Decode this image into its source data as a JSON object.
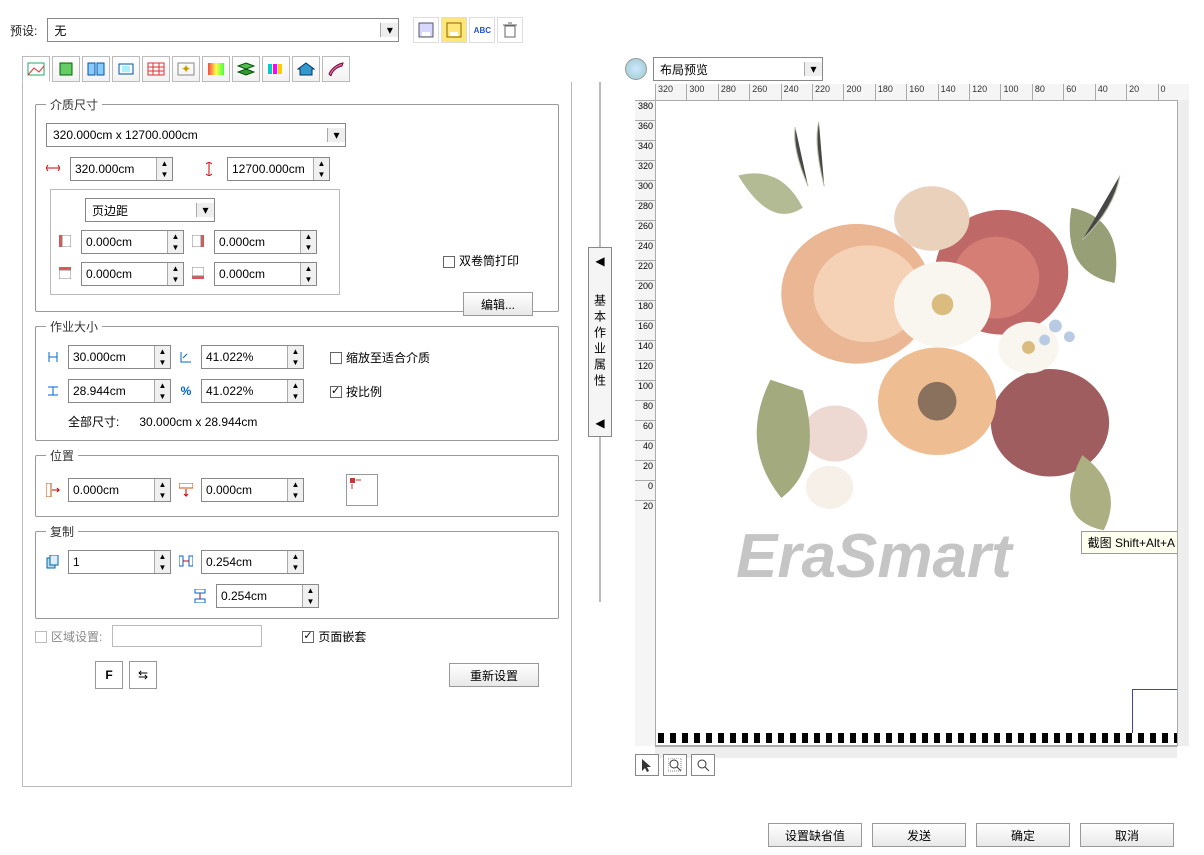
{
  "top": {
    "preset_label": "预设:",
    "preset_value": "无"
  },
  "top_icons": [
    "save-icon",
    "save-as-icon",
    "abc-icon",
    "delete-icon"
  ],
  "tabs": [
    "layout",
    "page",
    "tile",
    "crop",
    "grid",
    "stars",
    "gradients",
    "layers",
    "colors",
    "home",
    "brush"
  ],
  "media": {
    "legend": "介质尺寸",
    "size_combo": "320.000cm x 12700.000cm",
    "width": "320.000cm",
    "height": "12700.000cm",
    "margin_combo": "页边距",
    "m_left": "0.000cm",
    "m_right": "0.000cm",
    "m_top": "0.000cm",
    "m_bottom": "0.000cm",
    "double_roll": "双卷筒打印",
    "edit_btn": "编辑..."
  },
  "job": {
    "legend": "作业大小",
    "w": "30.000cm",
    "w_pct": "41.022%",
    "h": "28.944cm",
    "h_pct": "41.022%",
    "fit_media": "缩放至适合介质",
    "keep_ratio": "按比例",
    "total_label": "全部尺寸:",
    "total_value": "30.000cm x 28.944cm"
  },
  "pos": {
    "legend": "位置",
    "x": "0.000cm",
    "y": "0.000cm"
  },
  "copy": {
    "legend": "复制",
    "count": "1",
    "gx": "0.254cm",
    "gy": "0.254cm"
  },
  "area": {
    "label": "区域设置:",
    "nest": "页面嵌套",
    "reset": "重新设置"
  },
  "mid_tab": "基本作业属性",
  "preview": {
    "combo": "布局预览",
    "ruler_h": [
      "320",
      "300",
      "280",
      "260",
      "240",
      "220",
      "200",
      "180",
      "160",
      "140",
      "120",
      "100",
      "80",
      "60",
      "40",
      "20",
      "0"
    ],
    "ruler_v": [
      "380",
      "360",
      "340",
      "320",
      "300",
      "280",
      "260",
      "240",
      "220",
      "200",
      "180",
      "160",
      "140",
      "120",
      "100",
      "80",
      "60",
      "40",
      "20",
      "0",
      "20"
    ],
    "watermark": "EraSmart",
    "tip": "截图 Shift+Alt+A"
  },
  "footer": {
    "defaults": "设置缺省值",
    "send": "发送",
    "ok": "确定",
    "cancel": "取消"
  }
}
